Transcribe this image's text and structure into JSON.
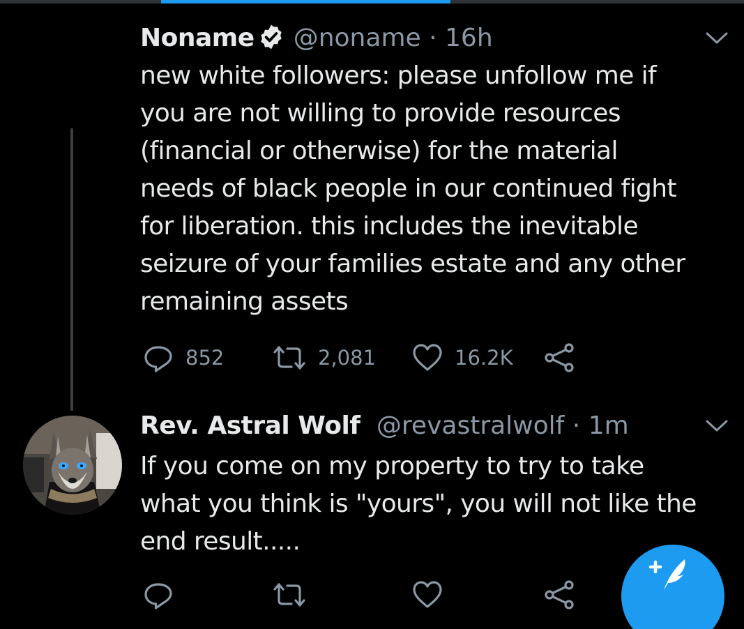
{
  "colors": {
    "background": "#000000",
    "text_primary": "#e7e9ea",
    "text_secondary": "#8b98a5",
    "accent": "#1d9bf0"
  },
  "tweets": [
    {
      "display_name": "Noname",
      "verified": true,
      "handle": "@noname",
      "separator": "·",
      "time": "16h",
      "text": "new white followers: please unfollow me if\nyou are not willing to provide resources\n(financial or otherwise) for the material\nneeds of black people in our continued fight\nfor liberation. this includes the inevitable\nseizure of your families estate and any other\nremaining assets",
      "reply_count": "852",
      "retweet_count": "2,081",
      "like_count": "16.2K"
    },
    {
      "display_name": "Rev. Astral Wolf",
      "verified": false,
      "handle": "@revastralwolf",
      "separator": "·",
      "time": "1m",
      "text": "If you come on my property to try to take\nwhat you think is \"yours\", you will not like the\nend result.....",
      "reply_count": "",
      "retweet_count": "",
      "like_count": ""
    }
  ],
  "icons": {
    "verified": "verified-badge-icon",
    "more": "chevron-down-icon",
    "reply": "reply-icon",
    "retweet": "retweet-icon",
    "like": "heart-icon",
    "share": "share-icon",
    "compose": "compose-tweet-icon"
  }
}
